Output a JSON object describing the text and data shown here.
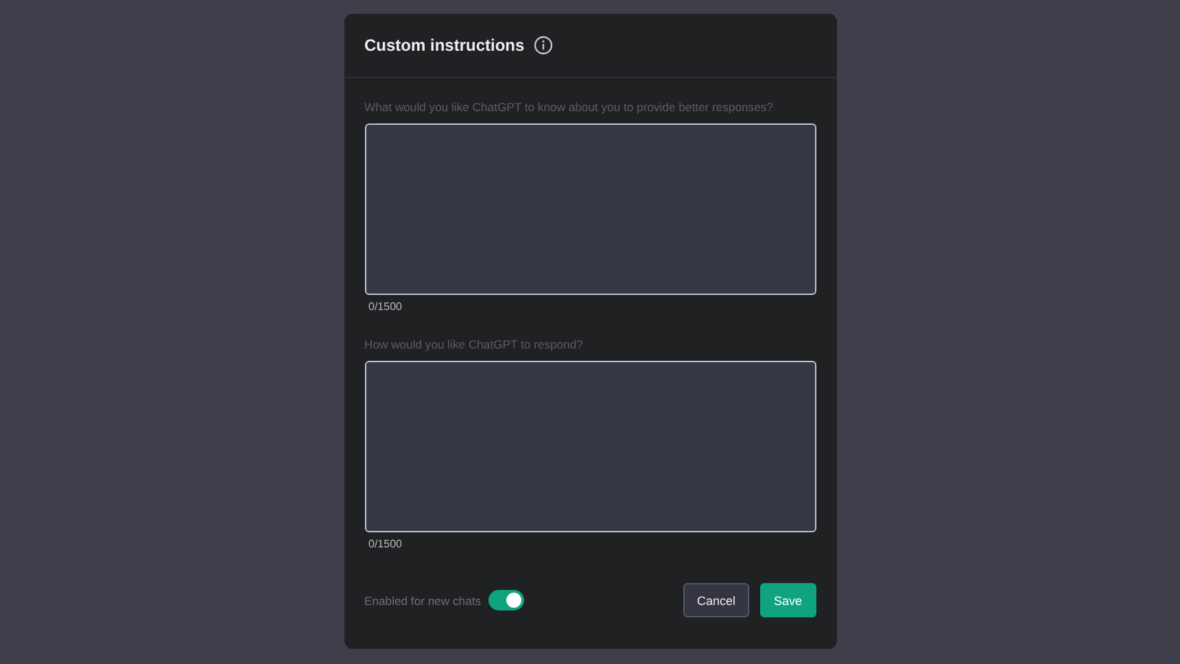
{
  "dialog": {
    "title": "Custom instructions"
  },
  "fields": [
    {
      "label": "What would you like ChatGPT to know about you to provide better responses?",
      "counter": "0/1500"
    },
    {
      "label": "How would you like ChatGPT to respond?",
      "counter": "0/1500"
    }
  ],
  "toggle": {
    "label": "Enabled for new chats",
    "on": true
  },
  "buttons": [
    {
      "label": "Cancel",
      "kind": "secondary"
    },
    {
      "label": "Save",
      "kind": "primary"
    }
  ]
}
